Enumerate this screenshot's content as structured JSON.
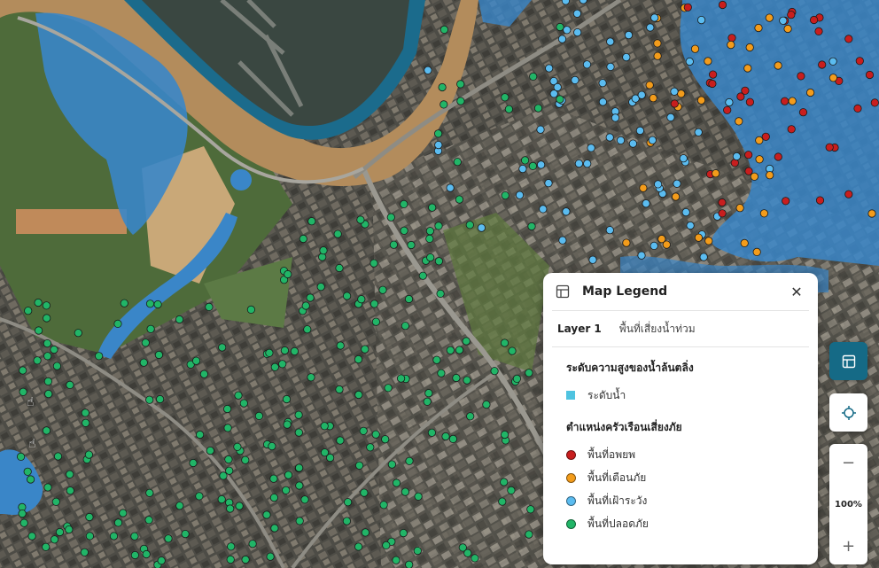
{
  "legend": {
    "title": "Map Legend",
    "title_icon": "layout-panel-icon",
    "close_icon": "close-icon",
    "layer_name": "Layer 1",
    "layer_value": "พื้นที่เสี่ยงน้ำท่วม",
    "section1_title": "ระดับความสูงของน้ำล้นตลิ่ง",
    "water_label": "ระดับน้ำ",
    "water_color": "#4fc3e0",
    "section2_title": "ตำแหน่งครัวเรือนเสี่ยงภัย",
    "items": [
      {
        "label": "พื้นที่อพยพ",
        "color": "#c81e1e"
      },
      {
        "label": "พื้นที่เตือนภัย",
        "color": "#f39c1b"
      },
      {
        "label": "พื้นที่เฝ้าระวัง",
        "color": "#5bbcf0"
      },
      {
        "label": "พื้นที่ปลอดภัย",
        "color": "#21b567"
      }
    ]
  },
  "controls": {
    "legend_button_icon": "legend-icon",
    "locate_button_icon": "locate-crosshair-icon",
    "zoom_out_label": "−",
    "zoom_in_label": "+",
    "zoom_level": "100%"
  },
  "map": {
    "flood_color": "#3a86c8",
    "river_color": "#b38c5c",
    "river_edge_color": "#1b6b8c"
  }
}
